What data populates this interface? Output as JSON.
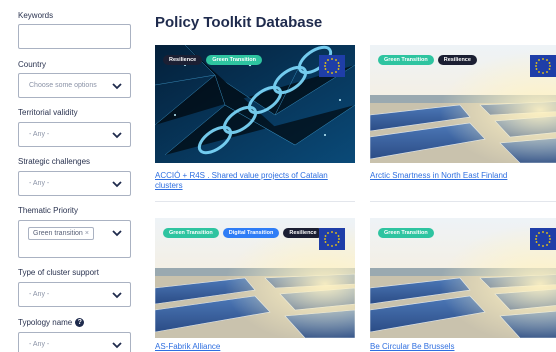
{
  "page": {
    "title": "Policy Toolkit Database"
  },
  "filters": {
    "keywords": {
      "label": "Keywords",
      "value": ""
    },
    "country": {
      "label": "Country",
      "placeholder": "Choose some options"
    },
    "territorial": {
      "label": "Territorial validity",
      "value": "- Any -"
    },
    "strategic": {
      "label": "Strategic challenges",
      "value": "- Any -"
    },
    "thematic": {
      "label": "Thematic Priority",
      "tag": "Green transition",
      "tag_remove": "×"
    },
    "support": {
      "label": "Type of cluster support",
      "value": "- Any -"
    },
    "typology": {
      "label": "Typology name",
      "help": "?",
      "value": "- Any -"
    }
  },
  "cards": [
    {
      "title": "ACCIÓ + R4S . Shared value projects of Catalan clusters",
      "badges": [
        "Resilience",
        "Green Transition"
      ],
      "image": "chain-network"
    },
    {
      "title": "Arctic Smartness in North East Finland",
      "badges": [
        "Green Transition",
        "Resilience"
      ],
      "image": "solar-panels"
    },
    {
      "title": "AS-Fabrik Alliance",
      "badges": [
        "Green Transition",
        "Digital Transition",
        "Resilience"
      ],
      "image": "solar-panels"
    },
    {
      "title": "Be Circular Be Brussels",
      "badges": [
        "Green Transition"
      ],
      "image": "solar-panels"
    }
  ],
  "colors": {
    "accent": "#2f6fe0",
    "green_badge": "#2ec4a0",
    "digital_badge": "#2f7df6",
    "resilience_badge": "#1b1f33",
    "eu_blue": "#1f3ea8",
    "eu_star": "#ffd200"
  }
}
